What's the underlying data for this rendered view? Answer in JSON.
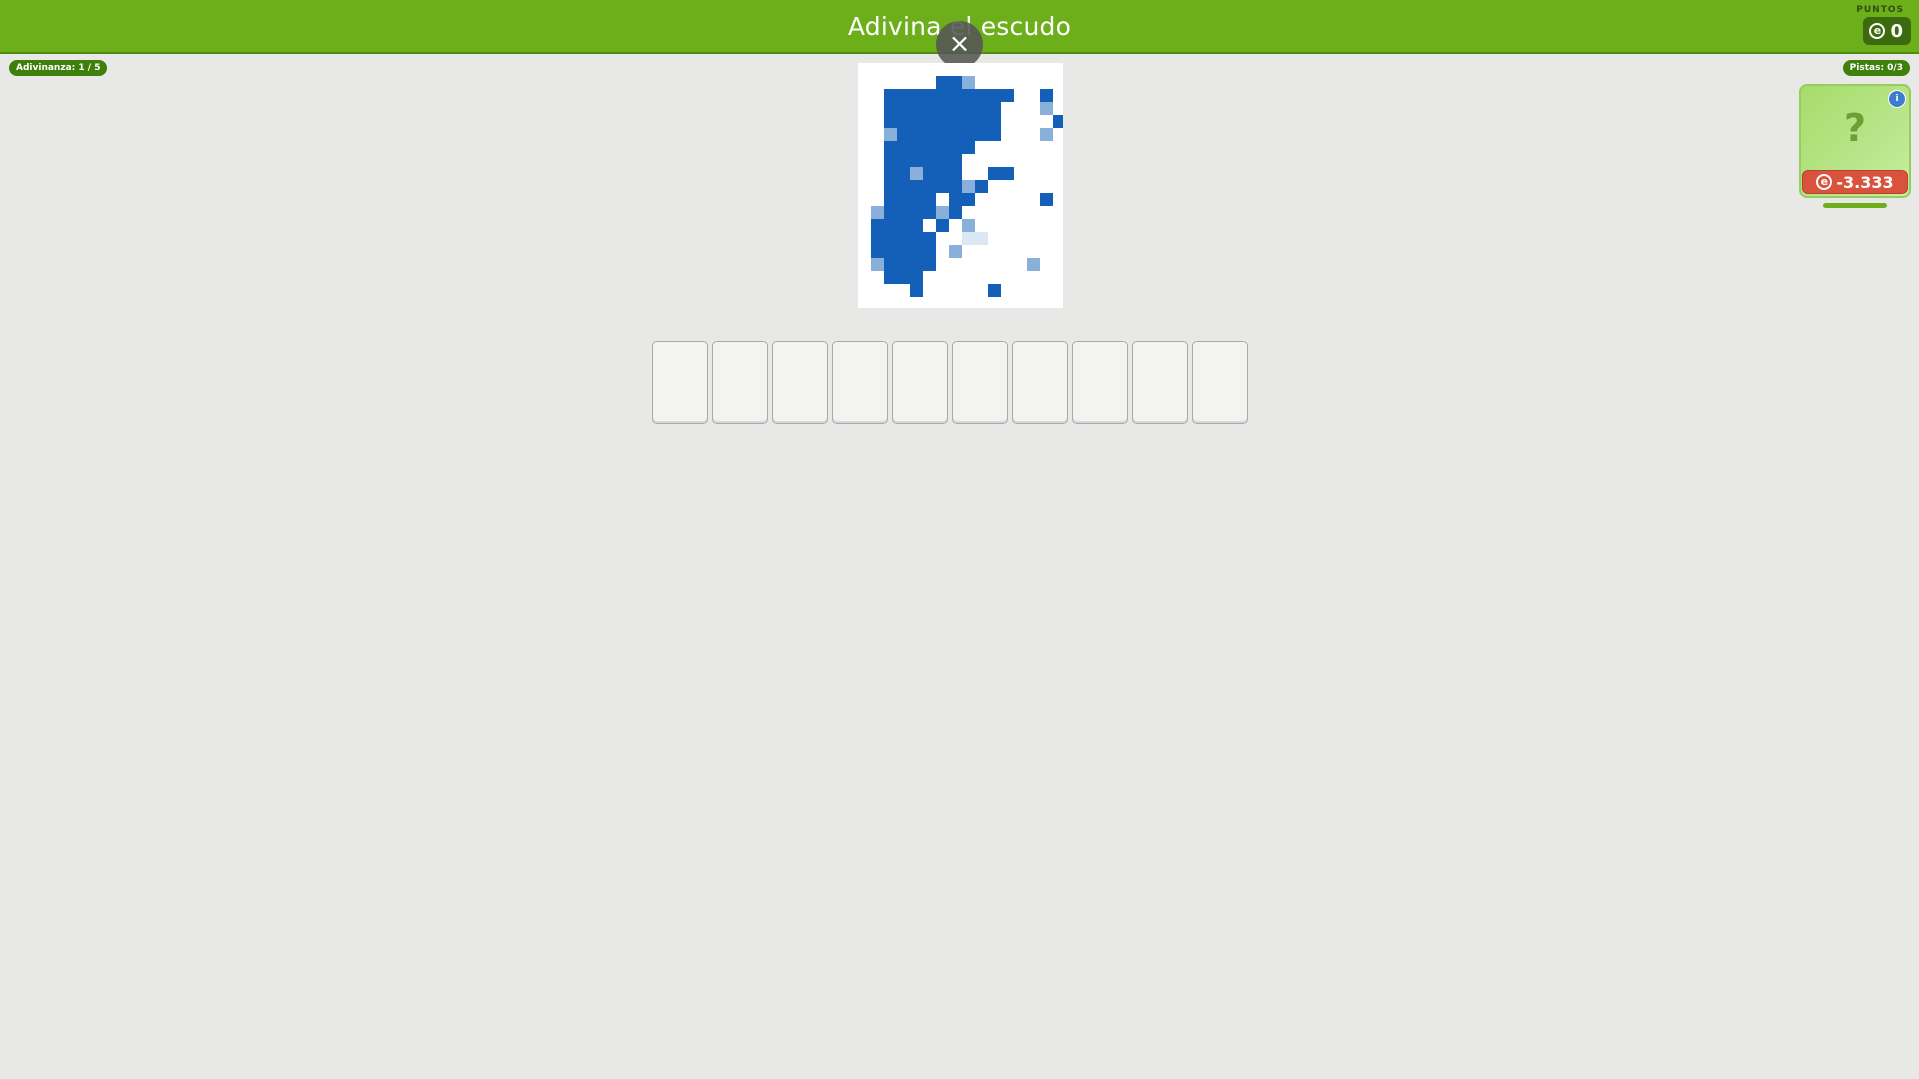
{
  "header": {
    "title": "Adivina el escudo",
    "close_glyph": "×",
    "points_label": "PUNTOS",
    "points_value": "0",
    "coin_glyph": "e"
  },
  "status": {
    "riddle_counter": "Adivinanza: 1 / 5",
    "hints_counter": "Pistas: 0/3"
  },
  "puzzle": {
    "image_description_icon": "pixelated-crest-image",
    "pixel_color": "#1460b8",
    "answer_length": 10
  },
  "hint_card": {
    "icon": "question-mark-icon",
    "question_glyph": "?",
    "info_glyph": "i",
    "cost": "-3.333",
    "coin_glyph": "e"
  },
  "colors": {
    "header_green": "#6caf1b",
    "pill_green": "#3f7f0c",
    "cost_red": "#d9533c",
    "background": "#e8e8e7"
  }
}
